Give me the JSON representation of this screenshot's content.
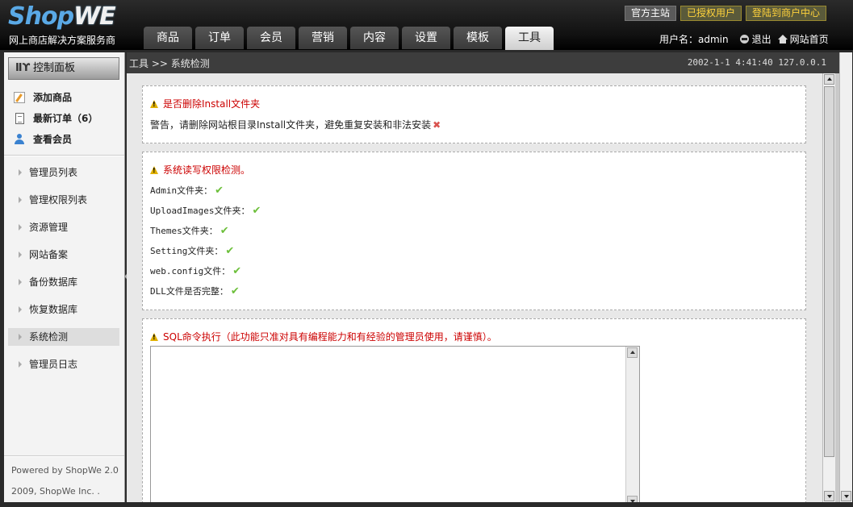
{
  "brand": {
    "logo_part1": "Shop",
    "logo_part2": "WE",
    "tagline": "网上商店解决方案服务商"
  },
  "nav": {
    "tabs": [
      {
        "label": "商品"
      },
      {
        "label": "订单"
      },
      {
        "label": "会员"
      },
      {
        "label": "营销"
      },
      {
        "label": "内容"
      },
      {
        "label": "设置"
      },
      {
        "label": "模板"
      },
      {
        "label": "工具"
      }
    ],
    "active_index": 7
  },
  "toplinks": {
    "official": "官方主站",
    "authorized": "已授权用户",
    "merchant_login": "登陆到商户中心"
  },
  "userbar": {
    "username": "用户名：admin",
    "logout": "退出",
    "home": "网站首页"
  },
  "sidebar": {
    "title": "控制面板",
    "title_icon": "tools-icon",
    "quick": [
      {
        "label": "添加商品",
        "icon": "pencil-icon"
      },
      {
        "label": "最新订单（6）",
        "icon": "document-icon"
      },
      {
        "label": "查看会员",
        "icon": "user-icon"
      }
    ],
    "menu": [
      {
        "label": "管理员列表"
      },
      {
        "label": "管理权限列表"
      },
      {
        "label": "资源管理"
      },
      {
        "label": "网站备案"
      },
      {
        "label": "备份数据库"
      },
      {
        "label": "恢复数据库"
      },
      {
        "label": "系统检测"
      },
      {
        "label": "管理员日志"
      }
    ],
    "active_menu": "系统检测",
    "powered": "Powered by ShopWe 2.0",
    "copyright": "2009, ShopWe Inc. ."
  },
  "breadcrumb": {
    "text": "工具 >> 系统检测",
    "timestamp": "2002-1-1 4:41:40 127.0.0.1"
  },
  "install_box": {
    "heading": "是否删除Install文件夹",
    "message": "警告，请删除网站根目录Install文件夹，避免重复安装和非法安装"
  },
  "perm_box": {
    "heading": "系统读写权限检测。",
    "checks": [
      {
        "label": "Admin文件夹："
      },
      {
        "label": "UploadImages文件夹："
      },
      {
        "label": "Themes文件夹："
      },
      {
        "label": "Setting文件夹："
      },
      {
        "label": "web.config文件："
      },
      {
        "label": "DLL文件是否完整："
      }
    ]
  },
  "sql_box": {
    "heading": "SQL命令执行（此功能只准对具有编程能力和有经验的管理员使用，请谨慎）。",
    "input_value": ""
  },
  "colors": {
    "warning_red": "#cc0000",
    "check_green": "#6cbf3a",
    "cross_red": "#d9534f",
    "gold": "#ffd23c"
  }
}
